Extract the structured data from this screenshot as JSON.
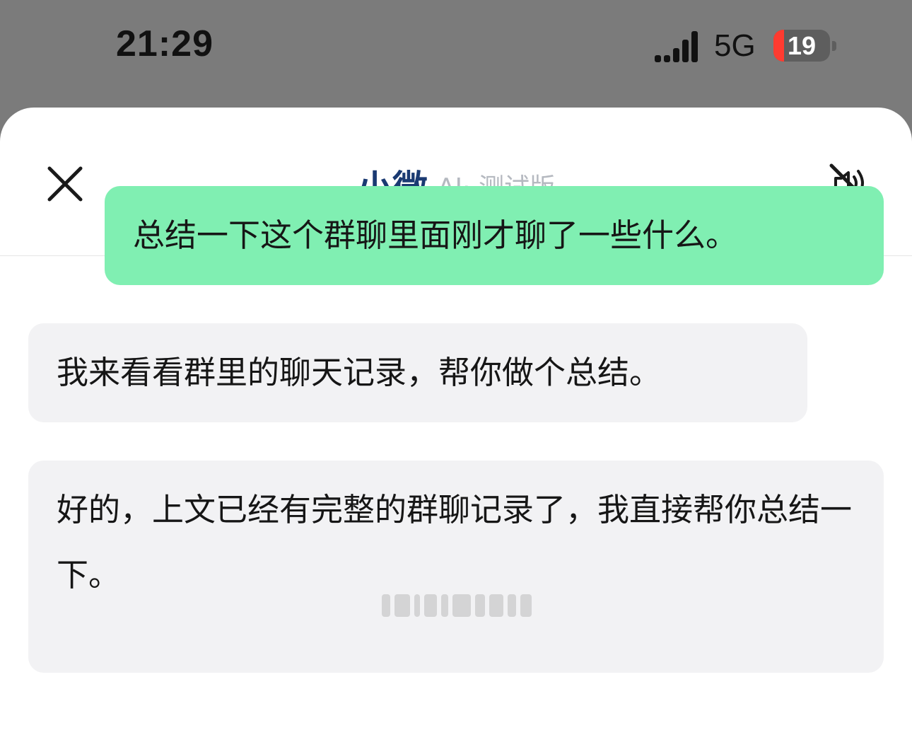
{
  "status_bar": {
    "time": "21:29",
    "network": "5G",
    "battery_level": "19",
    "battery_fraction": 0.19,
    "signal_icon": "signal-bars-icon"
  },
  "header": {
    "close_icon": "close-icon",
    "title": "小微",
    "subtitle": "AI· 测试版",
    "mute_icon": "speaker-muted-icon",
    "title_color": "#1a3a72"
  },
  "messages": [
    {
      "role": "user",
      "text": "总结一下这个群聊里面刚才聊了一些什么。"
    },
    {
      "role": "assistant",
      "text": "我来看看群里的聊天记录，帮你做个总结。"
    },
    {
      "role": "assistant",
      "text": "好的，上文已经有完整的群聊记录了，我直接帮你总结一下。"
    }
  ],
  "colors": {
    "user_bubble": "#80efb2",
    "assistant_bubble": "#f2f2f4",
    "backdrop": "#7b7b7b"
  }
}
